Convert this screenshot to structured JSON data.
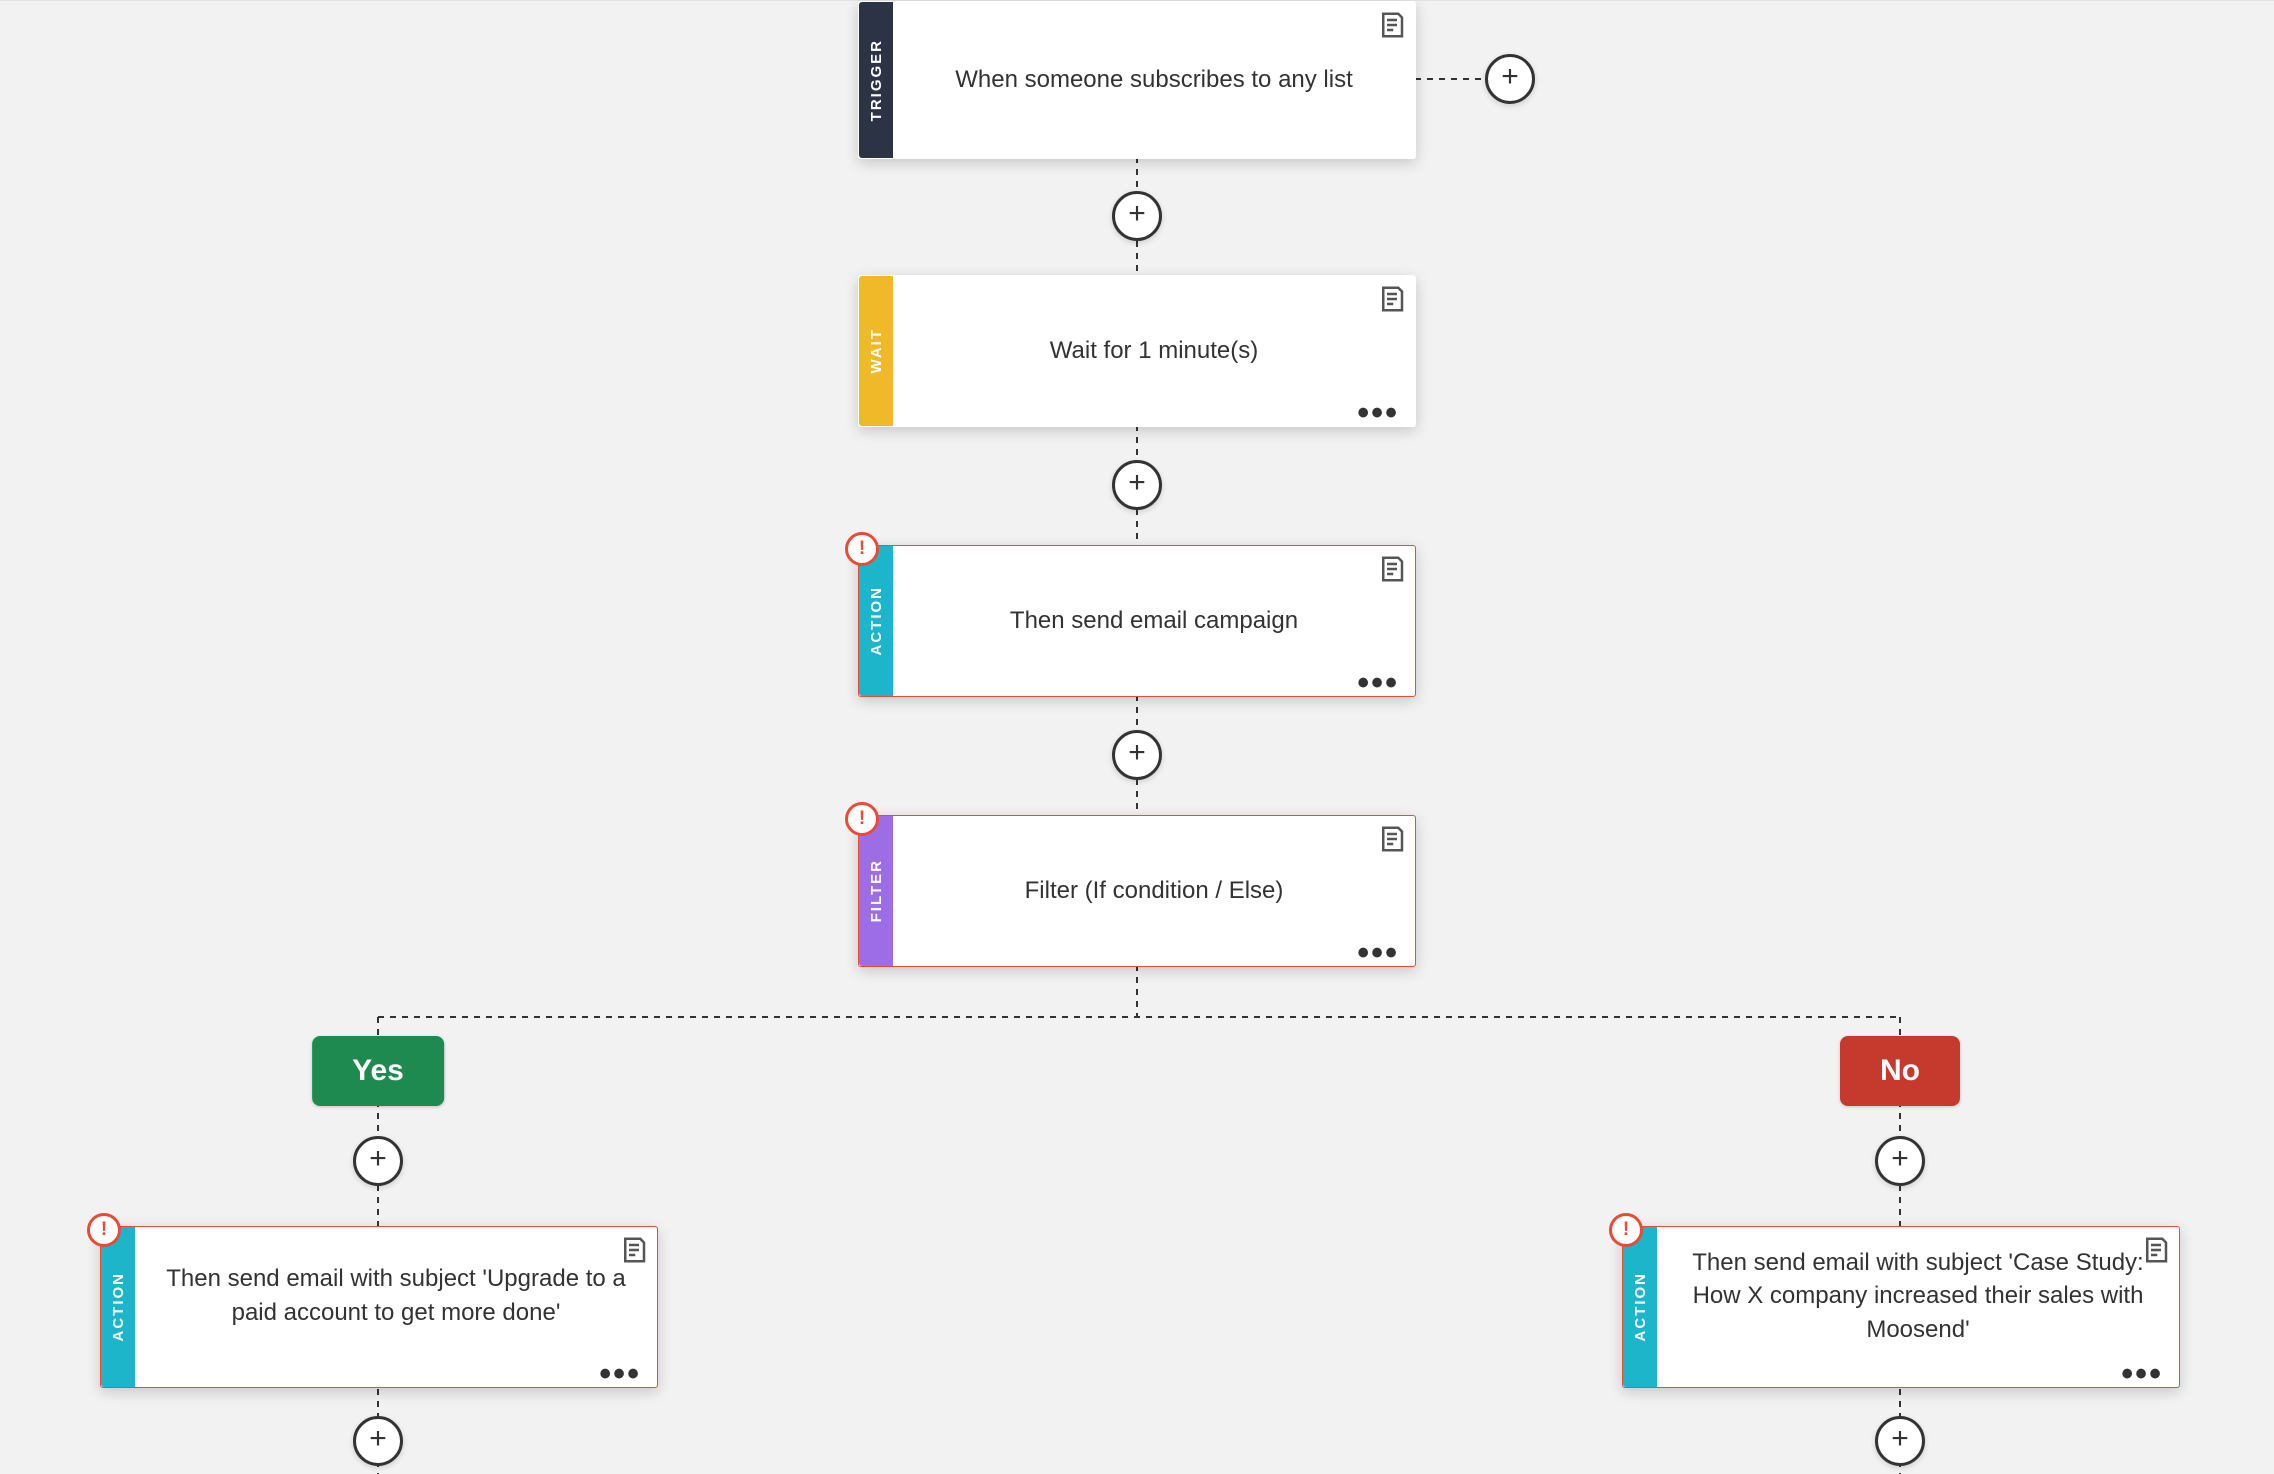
{
  "nodes": {
    "trigger": {
      "tab": "TRIGGER",
      "text": "When someone subscribes to any list"
    },
    "wait": {
      "tab": "WAIT",
      "text": "Wait for 1 minute(s)"
    },
    "action1": {
      "tab": "ACTION",
      "text": "Then send email campaign"
    },
    "filter": {
      "tab": "FILTER",
      "text": "Filter (If condition / Else)"
    },
    "actionYes": {
      "tab": "ACTION",
      "text": "Then send email with subject 'Upgrade to a paid account to get more done'"
    },
    "actionNo": {
      "tab": "ACTION",
      "text": "Then send email with subject 'Case Study: How X company increased their sales with Moosend'"
    }
  },
  "branches": {
    "yes": "Yes",
    "no": "No"
  },
  "glyphs": {
    "ellipsis": "•••",
    "error": "!"
  }
}
